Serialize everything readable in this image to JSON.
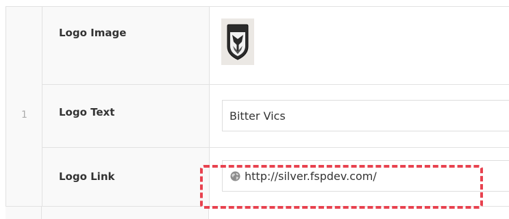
{
  "repeater": {
    "row_number": "1",
    "fields": {
      "logo_image": {
        "label": "Logo Image",
        "icon": "shield-logo-icon"
      },
      "logo_text": {
        "label": "Logo Text",
        "value": "Bitter Vics"
      },
      "logo_link": {
        "label": "Logo Link",
        "value": "http://silver.fspdev.com/",
        "icon": "globe-icon"
      }
    }
  },
  "colors": {
    "highlight": "#e8424f",
    "label_bg": "#f9f9f9",
    "border": "#e1e1e1"
  }
}
